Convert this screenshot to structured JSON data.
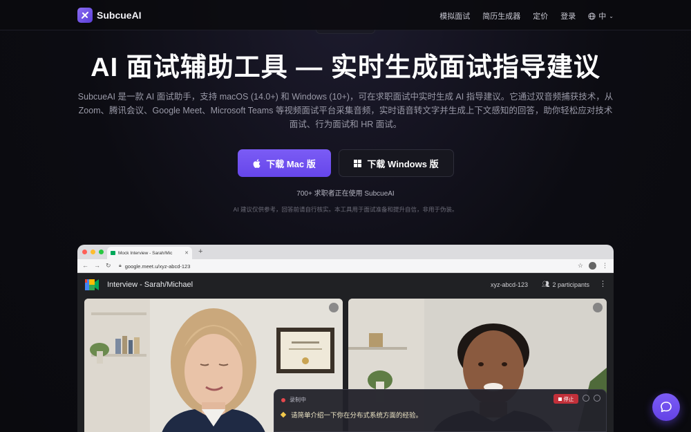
{
  "nav": {
    "brand": "SubcueAI",
    "links": [
      "模拟面试",
      "简历生成器",
      "定价",
      "登录"
    ],
    "language": "中"
  },
  "hero": {
    "title": "AI 面试辅助工具 — 实时生成面试指导建议",
    "description": "SubcueAI 是一款 AI 面试助手，支持 macOS (14.0+) 和 Windows (10+)，可在求职面试中实时生成 AI 指导建议。它通过双音频捕获技术，从 Zoom、腾讯会议、Google Meet、Microsoft Teams 等视频面试平台采集音频，实时语音转文字并生成上下文感知的回答，助你轻松应对技术面试、行为面试和 HR 面试。",
    "mac_button": "下载 Mac 版",
    "windows_button": "下载 Windows 版",
    "users": "700+ 求职者正在使用 SubcueAI",
    "disclaimer": "AI 建议仅供参考，回答前请自行核实。本工具用于面试准备和提升自信，非用于伪装。"
  },
  "browser": {
    "tab_title": "Mock Interview - Sarah/Mic",
    "url": "google.meet.u/xyz-abcd-123"
  },
  "meet": {
    "title": "Interview - Sarah/Michael",
    "code": "xyz-abcd-123",
    "participants": "2 participants"
  },
  "recorder": {
    "status": "录制中",
    "stop_label": "停止",
    "question": "请简单介绍一下你在分布式系统方面的经验。"
  },
  "colors": {
    "accent": "#6f50f0",
    "record_red": "#c2303a"
  }
}
